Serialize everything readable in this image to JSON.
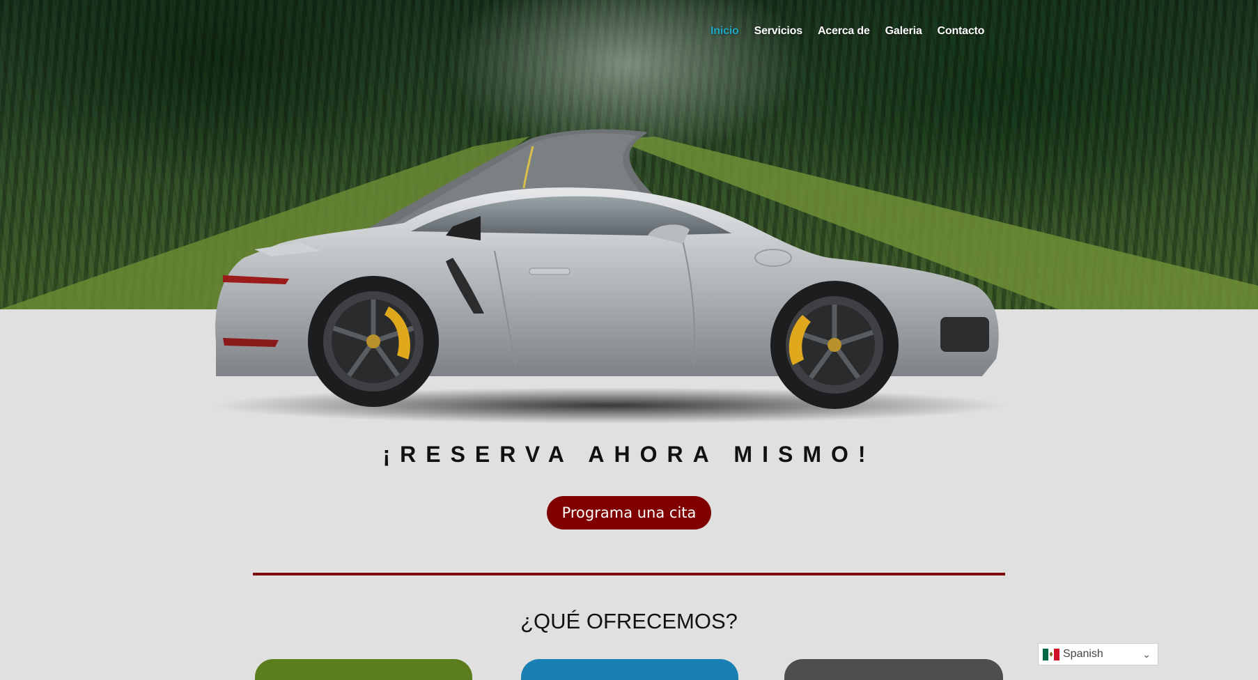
{
  "nav": {
    "items": [
      {
        "label": "Inicio",
        "active": true
      },
      {
        "label": "Servicios",
        "active": false
      },
      {
        "label": "Acerca de",
        "active": false
      },
      {
        "label": "Galeria",
        "active": false
      },
      {
        "label": "Contacto",
        "active": false
      }
    ],
    "active_color": "#1ea7c5",
    "text_color": "#ffffff"
  },
  "hero": {
    "background": "forest-road-photo",
    "car": "silver-sports-car"
  },
  "main": {
    "headline": "¡RESERVA AHORA MISMO!",
    "cta_label": "Programa una cita",
    "cta_color": "#800000",
    "divider_color": "#7d0a0a",
    "section_title": "¿QUÉ OFRECEMOS?",
    "card_colors": [
      "#5b7d1e",
      "#1a7fb3",
      "#4e4e4e"
    ]
  },
  "language": {
    "selected": "Spanish",
    "flag_icon": "mexico-flag-icon",
    "chevron_icon": "chevron-down-icon"
  }
}
